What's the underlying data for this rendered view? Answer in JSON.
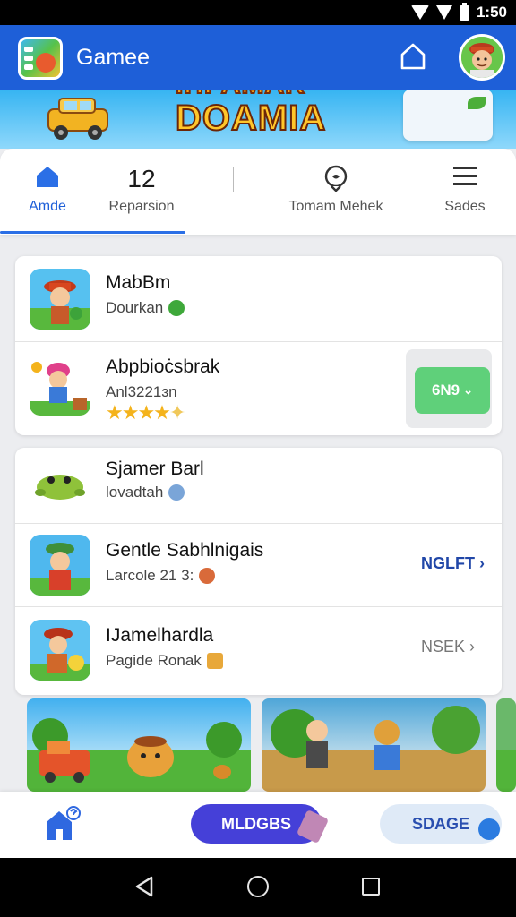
{
  "status_bar": {
    "time": "1:50"
  },
  "header": {
    "app_title": "Gamee"
  },
  "banner": {
    "logo_line1": "IHPAMAK",
    "logo_line2": "DOAMIA"
  },
  "tabs": [
    {
      "label": "Amde",
      "icon": "home-icon",
      "active": true
    },
    {
      "label": "Reparsion",
      "number": "12"
    },
    {
      "label": "Tomam Mehek",
      "icon": "pin-icon"
    },
    {
      "label": "Sades",
      "icon": "menu-icon"
    }
  ],
  "list": [
    {
      "title": "MabBm",
      "subtitle": "Dourkan"
    },
    {
      "title": "Abpbioċsbrak",
      "subtitle": "Anl3221ɜn",
      "rating": 4,
      "action": "6N9"
    },
    {
      "title": "Sjamer Barl",
      "subtitle": "lovadtah"
    },
    {
      "title": "Gentle Sabhlnigais",
      "subtitle": "Larcole 21 3:",
      "action": "NGLFT"
    },
    {
      "title": "IJamelhardla",
      "subtitle": "Pagide Ronak",
      "action": "NSEK"
    }
  ],
  "bottom_nav": {
    "pill_label": "MLDGBS",
    "pill2_label": "SDAGE"
  },
  "colors": {
    "primary": "#1e5fd8",
    "install": "#5fd07a",
    "pill": "#4540d8",
    "star": "#f4b31c"
  }
}
